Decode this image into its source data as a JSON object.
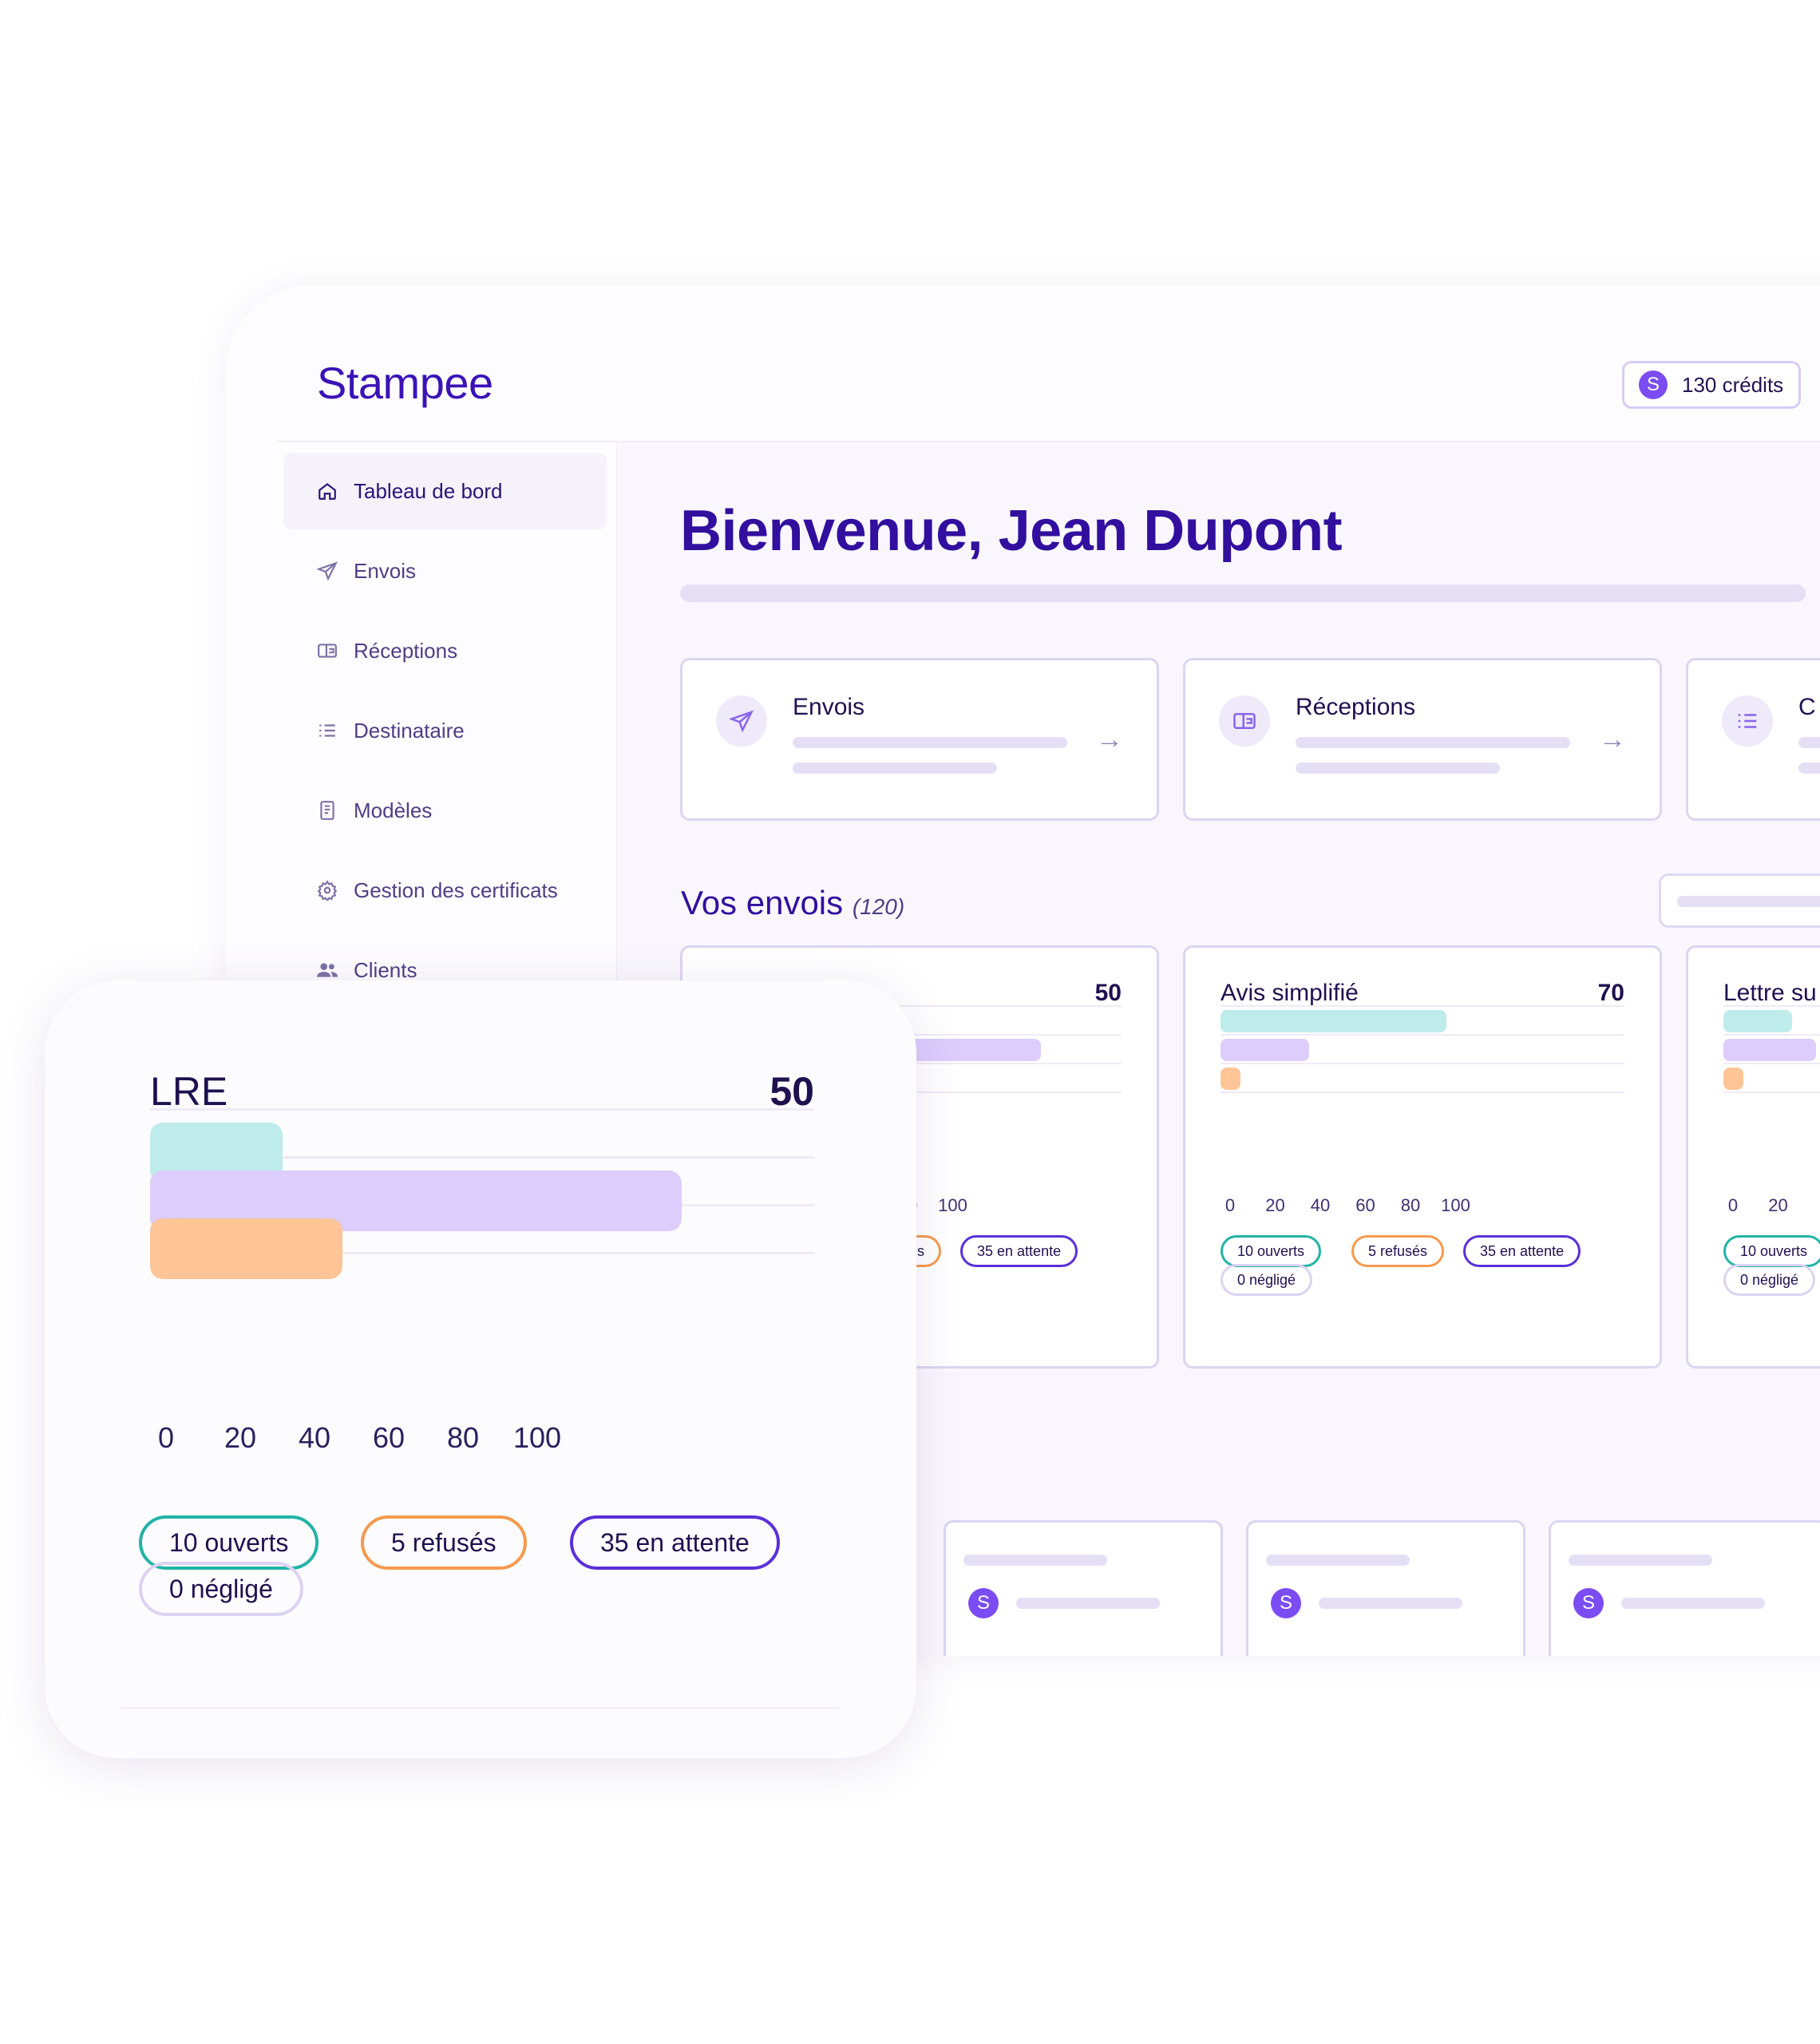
{
  "app": {
    "logo": "Stampee"
  },
  "header": {
    "credits_badge": "S",
    "credits_label": "130 crédits"
  },
  "sidebar": {
    "items": [
      {
        "label": "Tableau de bord",
        "icon": "home-icon",
        "active": true
      },
      {
        "label": "Envois",
        "icon": "send-icon",
        "active": false
      },
      {
        "label": "Réceptions",
        "icon": "inbox-icon",
        "active": false
      },
      {
        "label": "Destinataire",
        "icon": "list-icon",
        "active": false
      },
      {
        "label": "Modèles",
        "icon": "document-icon",
        "active": false
      },
      {
        "label": "Gestion des certificats",
        "icon": "certificate-icon",
        "active": false
      },
      {
        "label": "Clients",
        "icon": "users-icon",
        "active": false
      }
    ]
  },
  "main": {
    "welcome": "Bienvenue, Jean Dupont",
    "quick_cards": [
      {
        "title": "Envois",
        "icon": "send-icon"
      },
      {
        "title": "Réceptions",
        "icon": "inbox-icon"
      },
      {
        "title": "C",
        "icon": "list-icon"
      }
    ],
    "section_title": "Vos envois",
    "section_count": "(120)",
    "avatar_letter": "S"
  },
  "colors": {
    "brand": "#320f9e",
    "accent": "#7b4cf2",
    "opened": "#bdeceb",
    "pending": "#dccdfc",
    "refused": "#ffc597",
    "opened_border": "#22b3a6",
    "refused_border": "#f49a4e",
    "pending_border": "#5a30d8",
    "neglected_border": "#dcd2f2"
  },
  "chart_data": [
    {
      "type": "bar",
      "title": "LRE",
      "total": "50",
      "categories": [
        "ouverts",
        "en attente",
        "refusés"
      ],
      "values": [
        20,
        80,
        29
      ],
      "xlim": [
        0,
        100
      ],
      "xticks": [
        "0",
        "20",
        "40",
        "60",
        "80",
        "100"
      ],
      "pills": [
        "10 ouverts",
        "5 refusés",
        "35 en attente",
        "0 négligé"
      ]
    },
    {
      "type": "bar",
      "title": "Avis simplifié",
      "total": "70",
      "categories": [
        "ouverts",
        "en attente",
        "refusés"
      ],
      "values": [
        56,
        22,
        5
      ],
      "xlim": [
        0,
        100
      ],
      "xticks": [
        "0",
        "20",
        "40",
        "60",
        "80",
        "100"
      ],
      "pills": [
        "10 ouverts",
        "5 refusés",
        "35 en attente",
        "0 négligé"
      ]
    },
    {
      "type": "bar",
      "title": "Lettre su",
      "total": "",
      "categories": [
        "ouverts",
        "en attente",
        "refusés"
      ],
      "values": [
        17,
        23,
        5
      ],
      "xlim": [
        0,
        100
      ],
      "xticks": [
        "0",
        "20"
      ],
      "pills": [
        "10 ouverts",
        "0 négligé"
      ]
    }
  ]
}
